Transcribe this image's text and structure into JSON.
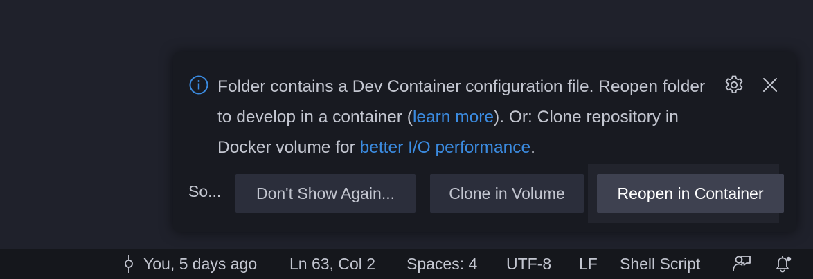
{
  "notification": {
    "message_part1": "Folder contains a Dev Container configuration file. Reopen folder to develop in a container (",
    "link_learn_more": "learn more",
    "message_part2": "). Or: Clone repository in Docker volume for ",
    "link_io_performance": "better I/O performance",
    "message_part3": ".",
    "source": "So...",
    "buttons": {
      "dont_show": "Don't Show Again...",
      "clone_volume": "Clone in Volume",
      "reopen": "Reopen in Container"
    },
    "icons": {
      "info": "info-icon",
      "settings": "gear-icon",
      "close": "close-icon"
    }
  },
  "statusbar": {
    "blame": "You, 5 days ago",
    "cursor_position": "Ln 63, Col 2",
    "indentation": "Spaces: 4",
    "encoding": "UTF-8",
    "line_ending": "LF",
    "language": "Shell Script",
    "icons": {
      "commit": "git-commit-icon",
      "feedback": "feedback-icon",
      "notifications": "bell-icon"
    }
  },
  "colors": {
    "link": "#3b8be0",
    "background": "#1f212b",
    "toast_background": "#181a21",
    "statusbar_background": "#15171c",
    "primary_button": "#3e4150",
    "secondary_button": "#2b2e3b"
  }
}
